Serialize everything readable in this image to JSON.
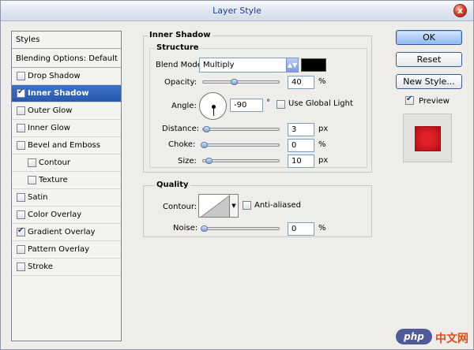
{
  "window": {
    "title": "Layer Style",
    "close": "x"
  },
  "styles_panel": {
    "header": "Styles",
    "blending": "Blending Options: Default",
    "items": [
      {
        "label": "Drop Shadow",
        "checked": false,
        "selected": false,
        "indent": false
      },
      {
        "label": "Inner Shadow",
        "checked": true,
        "selected": true,
        "indent": false
      },
      {
        "label": "Outer Glow",
        "checked": false,
        "selected": false,
        "indent": false
      },
      {
        "label": "Inner Glow",
        "checked": false,
        "selected": false,
        "indent": false
      },
      {
        "label": "Bevel and Emboss",
        "checked": false,
        "selected": false,
        "indent": false
      },
      {
        "label": "Contour",
        "checked": false,
        "selected": false,
        "indent": true
      },
      {
        "label": "Texture",
        "checked": false,
        "selected": false,
        "indent": true
      },
      {
        "label": "Satin",
        "checked": false,
        "selected": false,
        "indent": false
      },
      {
        "label": "Color Overlay",
        "checked": false,
        "selected": false,
        "indent": false
      },
      {
        "label": "Gradient Overlay",
        "checked": true,
        "selected": false,
        "indent": false
      },
      {
        "label": "Pattern Overlay",
        "checked": false,
        "selected": false,
        "indent": false
      },
      {
        "label": "Stroke",
        "checked": false,
        "selected": false,
        "indent": false
      }
    ]
  },
  "inner_shadow": {
    "title": "Inner Shadow",
    "structure": {
      "title": "Structure",
      "blend_mode_label": "Blend Mode:",
      "blend_mode_value": "Multiply",
      "color": "#000000",
      "opacity_label": "Opacity:",
      "opacity_value": "40",
      "opacity_unit": "%",
      "opacity_fraction": 0.4,
      "angle_label": "Angle:",
      "angle_value": "-90",
      "angle_unit": "°",
      "use_global_light_label": "Use Global Light",
      "use_global_light": false,
      "distance_label": "Distance:",
      "distance_value": "3",
      "distance_unit": "px",
      "choke_label": "Choke:",
      "choke_value": "0",
      "choke_unit": "%",
      "size_label": "Size:",
      "size_value": "10",
      "size_unit": "px"
    },
    "quality": {
      "title": "Quality",
      "contour_label": "Contour:",
      "anti_aliased_label": "Anti-aliased",
      "anti_aliased": false,
      "noise_label": "Noise:",
      "noise_value": "0",
      "noise_unit": "%"
    }
  },
  "buttons": {
    "ok": "OK",
    "reset": "Reset",
    "new_style": "New Style...",
    "preview_label": "Preview",
    "preview": true
  },
  "watermark": {
    "logo": "php",
    "text": "中文网"
  }
}
